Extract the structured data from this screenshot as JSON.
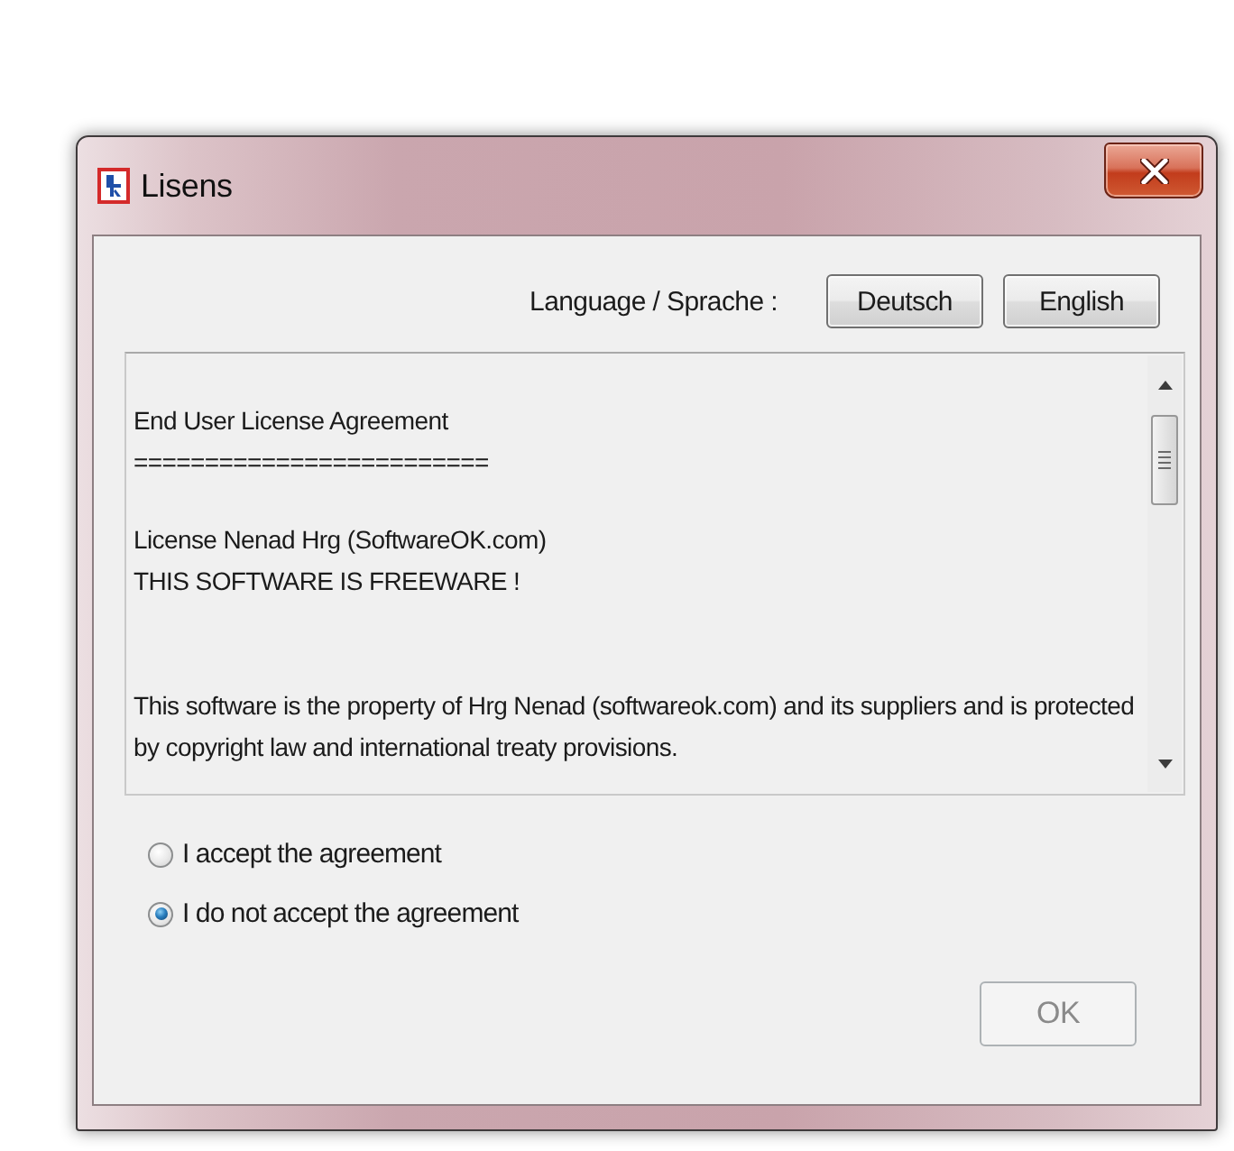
{
  "window": {
    "title": "Lisens"
  },
  "language": {
    "label": "Language / Sprache :",
    "buttons": [
      {
        "label": "Deutsch"
      },
      {
        "label": "English"
      }
    ]
  },
  "license_text": {
    "blocks": [
      {
        "lines": [
          "End User License Agreement",
          "========================="
        ]
      },
      {
        "lines": [
          "License Nenad Hrg (SoftwareOK.com)",
          "THIS SOFTWARE IS FREEWARE !"
        ]
      },
      {
        "lines": [
          "This software is the property of Hrg Nenad (softwareok.com) and its suppliers and is protected by copyright law and international treaty provisions."
        ]
      }
    ]
  },
  "agreement": [
    {
      "label": "I accept the agreement",
      "selected": false
    },
    {
      "label": "I do not accept the agreement",
      "selected": true
    }
  ],
  "ok_button": {
    "label": "OK",
    "disabled": true
  }
}
